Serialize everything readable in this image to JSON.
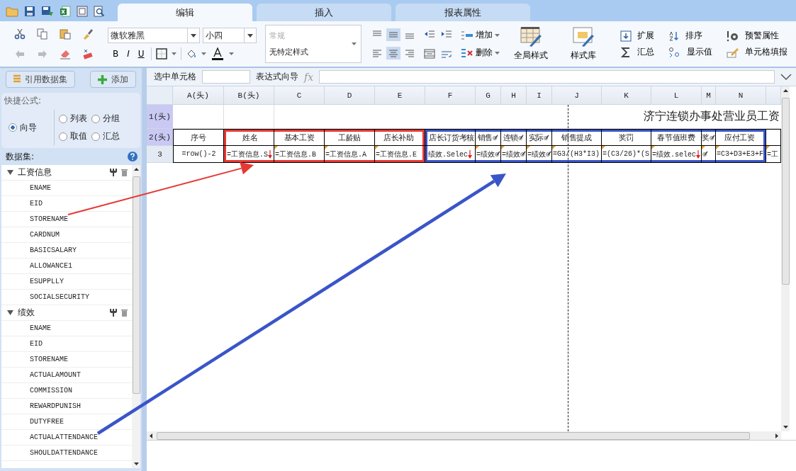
{
  "tabs": [
    {
      "label": "编辑",
      "selected": true
    },
    {
      "label": "插入",
      "selected": false
    },
    {
      "label": "报表属性",
      "selected": false
    }
  ],
  "ribbon": {
    "font_family": "微软雅黑",
    "font_size": "小四",
    "format_buttons": [
      "B",
      "I",
      "U"
    ],
    "style_list": [
      {
        "label": "常规",
        "disabled": true
      },
      {
        "label": "无特定样式",
        "disabled": false
      }
    ],
    "vertical_align": [
      {
        "kind": "top",
        "selected": false
      },
      {
        "kind": "middle",
        "selected": true
      },
      {
        "kind": "bottom",
        "selected": false
      }
    ],
    "horizontal_align": [
      {
        "kind": "left",
        "selected": false
      },
      {
        "kind": "center",
        "selected": true
      },
      {
        "kind": "right",
        "selected": false
      }
    ],
    "row_buttons": [
      {
        "label": "增加",
        "kind": "add"
      },
      {
        "label": "删除",
        "kind": "delete"
      }
    ],
    "large_buttons": [
      {
        "label": "全局样式",
        "kind": "global-style"
      },
      {
        "label": "样式库",
        "kind": "style-library"
      }
    ],
    "tools": [
      {
        "label": "扩展",
        "kind": "expand"
      },
      {
        "label": "排序",
        "kind": "sort"
      },
      {
        "label": "预警属性",
        "kind": "alert"
      },
      {
        "label": "汇总",
        "kind": "sum"
      },
      {
        "label": "显示值",
        "kind": "display"
      },
      {
        "label": "单元格填报",
        "kind": "fill"
      }
    ]
  },
  "sidebar": {
    "buttons": [
      {
        "label": "引用数据集",
        "kind": "dataset"
      },
      {
        "label": "添加",
        "kind": "add"
      }
    ],
    "quick_formula": {
      "title": "快捷公式:",
      "options": [
        {
          "label": "向导",
          "selected": true
        },
        {
          "label": "列表",
          "selected": false
        },
        {
          "label": "分组",
          "selected": false
        },
        {
          "label": "取值",
          "selected": false
        },
        {
          "label": "汇总",
          "selected": false
        }
      ]
    },
    "datasets": {
      "title": "数据集:",
      "items": [
        {
          "label": "工资信息",
          "expanded": true,
          "children": [
            {
              "label": "ENAME"
            },
            {
              "label": "EID"
            },
            {
              "label": "STORENAME"
            },
            {
              "label": "CARDNUM"
            },
            {
              "label": "BASICSALARY"
            },
            {
              "label": "ALLOWANCE1"
            },
            {
              "label": "ESUPPLLY"
            },
            {
              "label": "SOCIALSECURITY"
            }
          ]
        },
        {
          "label": "绩效",
          "expanded": true,
          "children": [
            {
              "label": "ENAME"
            },
            {
              "label": "EID"
            },
            {
              "label": "STORENAME"
            },
            {
              "label": "ACTUALAMOUNT"
            },
            {
              "label": "COMMISSION"
            },
            {
              "label": "REWARDPUNISH"
            },
            {
              "label": "DUTYFREE"
            },
            {
              "label": "ACTUALATTENDANCE"
            },
            {
              "label": "SHOULDATTENDANCE"
            }
          ]
        }
      ]
    }
  },
  "formula_bar": {
    "cell_label": "选中单元格",
    "expression_label": "表达式向导",
    "fx": "fx"
  },
  "sheet": {
    "columns": [
      "A(头)",
      "B(头)",
      "C",
      "D",
      "E",
      "F",
      "G",
      "H",
      "I",
      "J",
      "K",
      "L",
      "M",
      "N"
    ],
    "rows": [
      {
        "label": "1(头)",
        "head": true
      },
      {
        "label": "2(头)",
        "head": true
      },
      {
        "label": "3",
        "head": false
      }
    ],
    "title": "济宁连锁办事处营业员工资",
    "header_row": [
      {
        "text": "序号",
        "kind": "plain"
      },
      {
        "text": "姓名",
        "color": "#e53935",
        "kind": "plain"
      },
      {
        "text": "基本工资",
        "color": "#e53935",
        "kind": "plain"
      },
      {
        "text": "工龄贴",
        "color": "#e53935",
        "kind": "plain"
      },
      {
        "text": "店长补助",
        "color": "#e53935",
        "kind": "plain"
      },
      {
        "text": "店长订货考核",
        "color": "#3a55c8",
        "kind": "plain"
      },
      {
        "text": "销售",
        "color": "#3a55c8",
        "kind": "edit"
      },
      {
        "text": "连锁",
        "color": "#3a55c8",
        "kind": "edit"
      },
      {
        "text": "实际",
        "color": "#3a55c8",
        "kind": "edit"
      },
      {
        "text": "销售提成",
        "color": "#3a55c8",
        "kind": "plain"
      },
      {
        "text": "奖罚",
        "color": "#3a55c8",
        "kind": "plain"
      },
      {
        "text": "春节值班费",
        "color": "#3a55c8",
        "kind": "plain"
      },
      {
        "text": "奖",
        "color": "#3a55c8",
        "kind": "edit"
      },
      {
        "text": "应付工资",
        "color": "#3a55c8",
        "kind": "plain"
      },
      {
        "kind": "plain"
      }
    ],
    "formula_row": [
      {
        "text": "=row()-2",
        "marker": false,
        "kind": "plain"
      },
      {
        "text": "=工资信息.S",
        "marker": false,
        "kind": "expand"
      },
      {
        "text": "=工资信息.B",
        "marker": true,
        "kind": "plain"
      },
      {
        "text": "=工资信息.A",
        "marker": true,
        "kind": "plain"
      },
      {
        "text": "=工资信息.E",
        "marker": true,
        "kind": "plain"
      },
      {
        "text": "绩效.Selec",
        "marker": false,
        "kind": "expand"
      },
      {
        "text": "=绩效",
        "marker": true,
        "kind": "edit"
      },
      {
        "text": "=绩效",
        "marker": true,
        "kind": "edit"
      },
      {
        "text": "=绩效",
        "marker": true,
        "kind": "edit"
      },
      {
        "text": "=G3/(H3*I3)",
        "marker": true,
        "kind": "plain"
      },
      {
        "text": "=(C3/26)*(S",
        "marker": true,
        "kind": "plain"
      },
      {
        "text": "=绩效.selec",
        "marker": true,
        "kind": "expand"
      },
      {
        "marker": true,
        "kind": "edit"
      },
      {
        "text": "=C3+D3+E3+F",
        "marker": true,
        "kind": "plain"
      },
      {
        "text": "=工",
        "marker": true,
        "kind": "plain"
      }
    ]
  }
}
